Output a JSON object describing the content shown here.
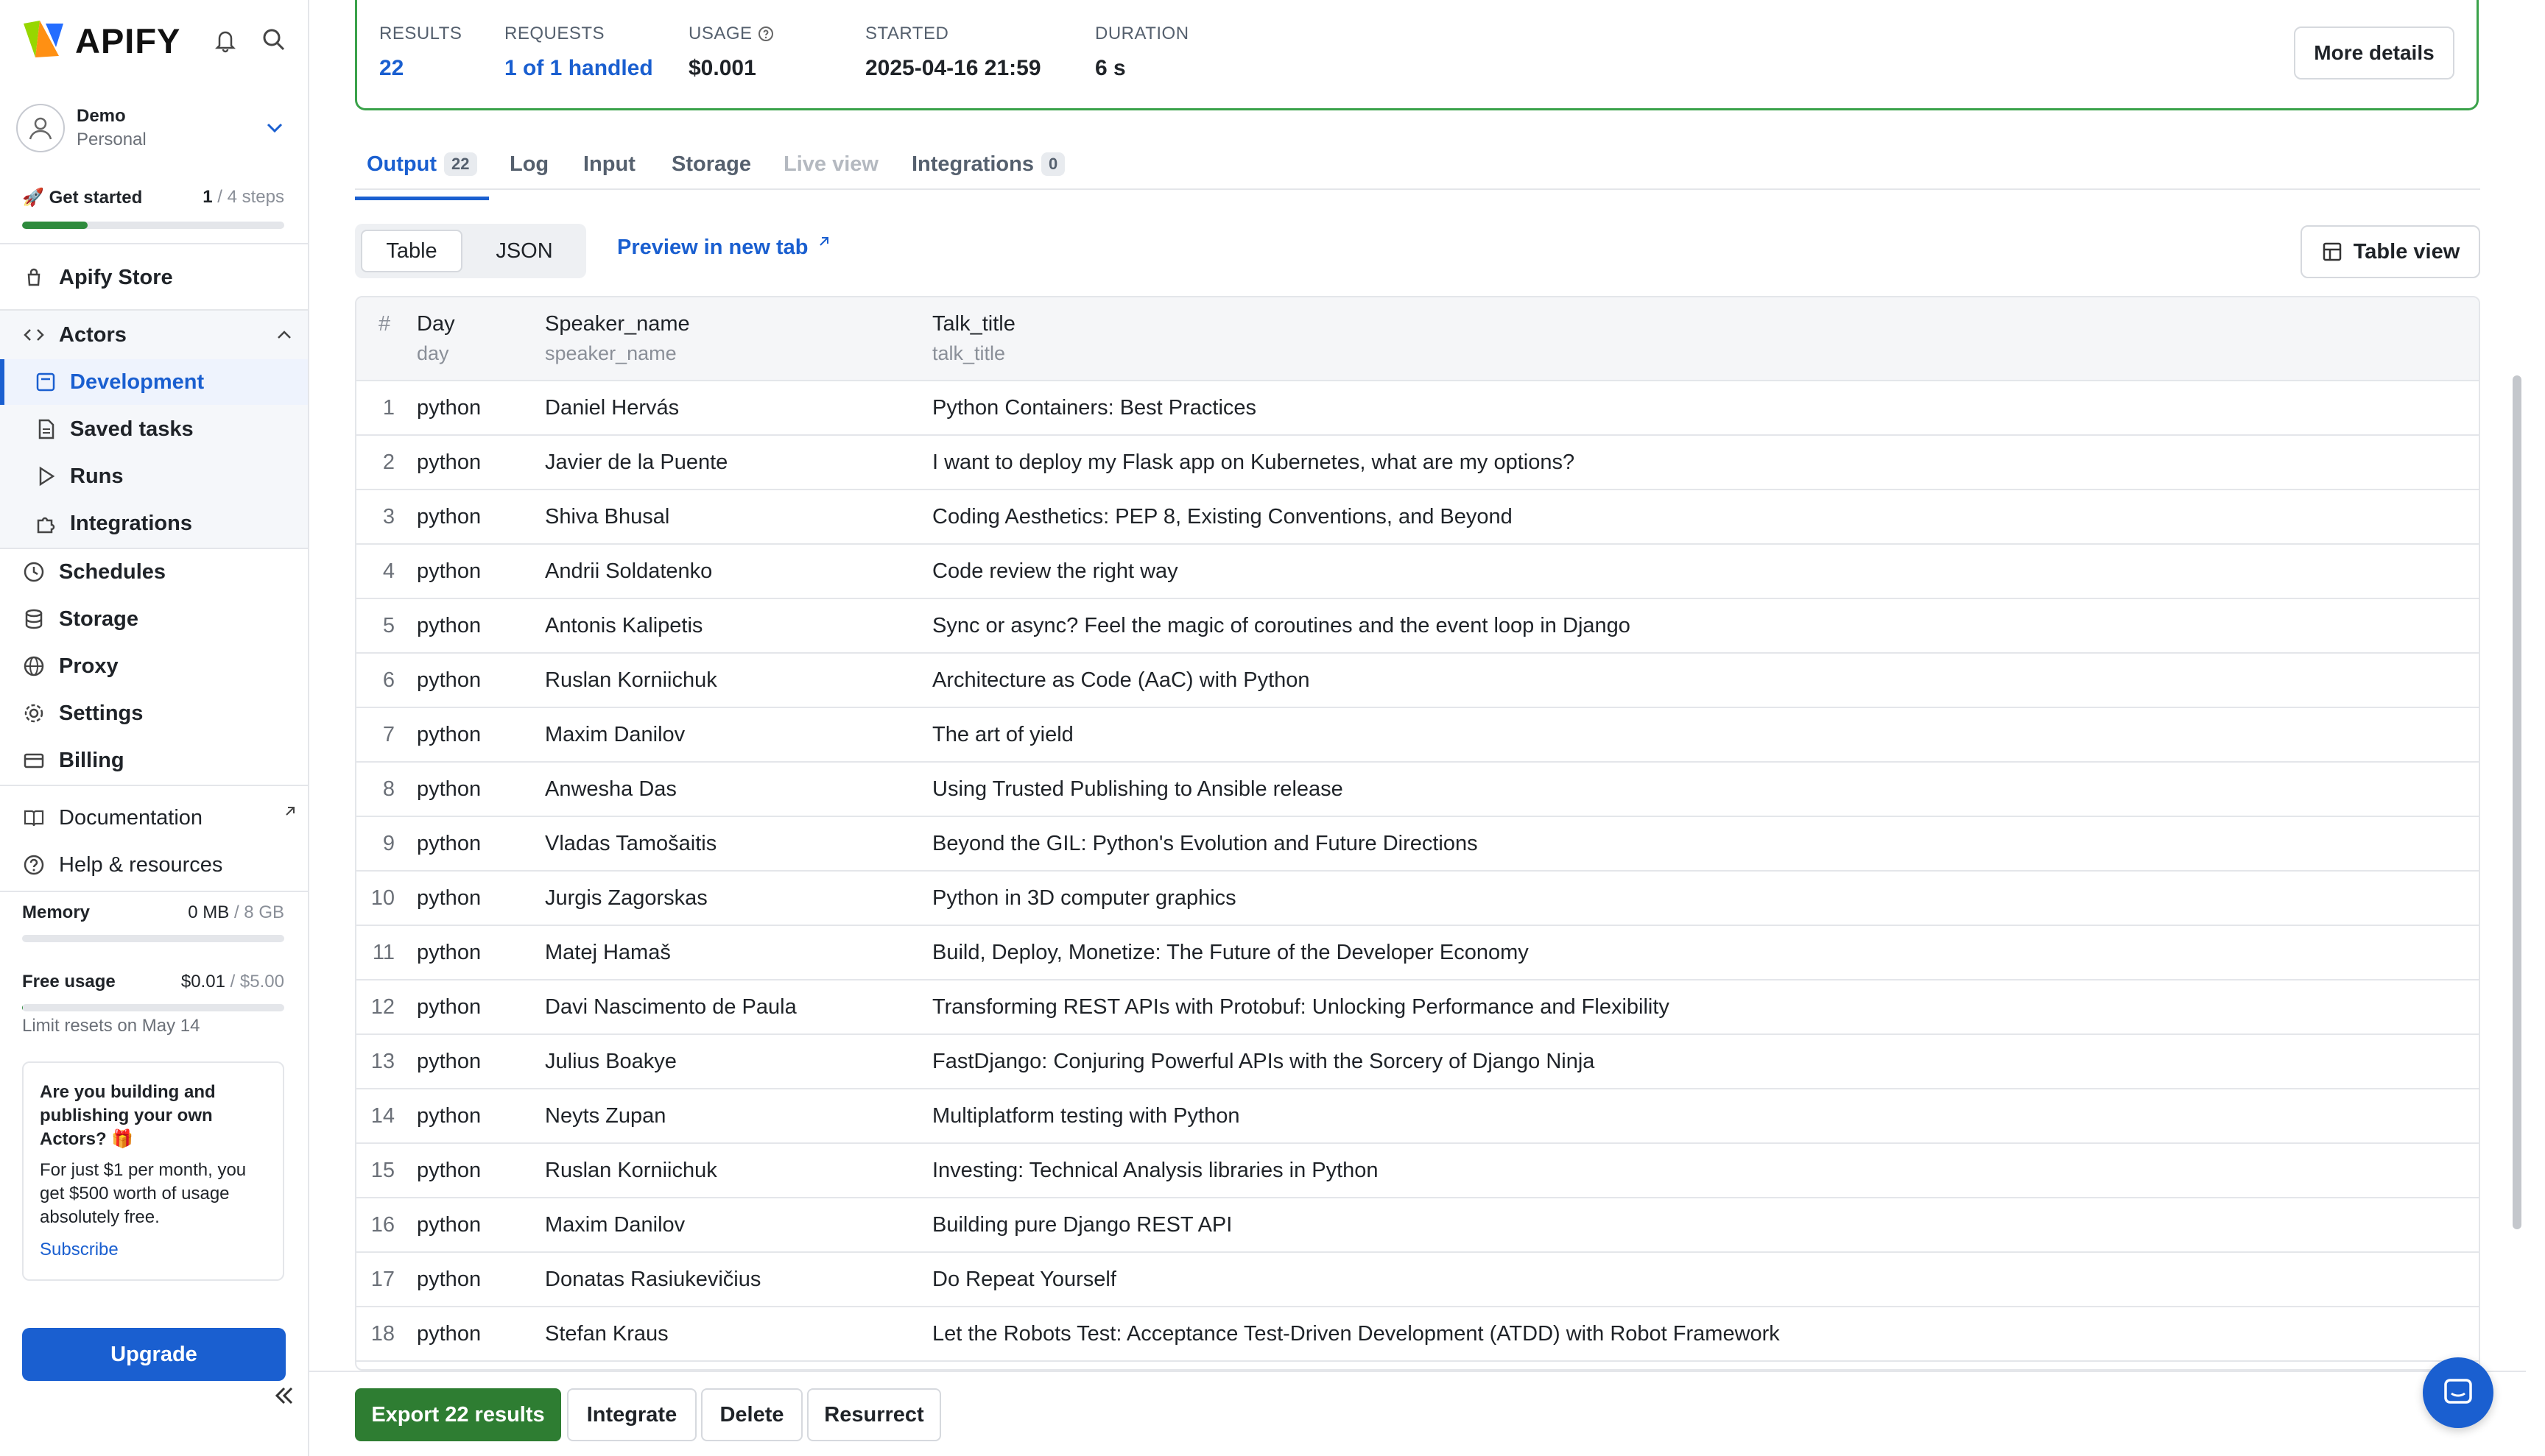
{
  "app": {
    "brand": "APIFY"
  },
  "account": {
    "name": "Demo",
    "type": "Personal"
  },
  "get_started": {
    "label": "Get started",
    "icon": "rocket",
    "current": "1",
    "total": "/ 4 steps",
    "progress": 0.25
  },
  "nav": {
    "store": "Apify Store",
    "actors": "Actors",
    "actor_items": [
      "Development",
      "Saved tasks",
      "Runs",
      "Integrations"
    ],
    "items": [
      "Schedules",
      "Storage",
      "Proxy",
      "Settings",
      "Billing"
    ],
    "docs": "Documentation",
    "help": "Help & resources"
  },
  "memory": {
    "label": "Memory",
    "used": "0 MB",
    "limit": "/ 8 GB",
    "fraction": 0.0
  },
  "usage": {
    "label": "Free usage",
    "used": "$0.01",
    "limit": "/ $5.00",
    "fraction": 0.002
  },
  "reset_note": "Limit resets on May 14",
  "promo": {
    "title": "Are you building and publishing your own Actors? 🎁",
    "body": "For just $1 per month, you get $500 worth of usage absolutely free.",
    "link": "Subscribe"
  },
  "upgrade": "Upgrade",
  "stats": {
    "results": {
      "label": "RESULTS",
      "value": "22"
    },
    "requests": {
      "label": "REQUESTS",
      "value": "1 of 1 handled"
    },
    "usage": {
      "label": "USAGE",
      "value": "$0.001"
    },
    "started": {
      "label": "STARTED",
      "value": "2025-04-16 21:59"
    },
    "duration": {
      "label": "DURATION",
      "value": "6 s"
    },
    "more": "More details"
  },
  "tabs": [
    {
      "label": "Output",
      "badge": "22"
    },
    {
      "label": "Log"
    },
    {
      "label": "Input"
    },
    {
      "label": "Storage"
    },
    {
      "label": "Live view"
    },
    {
      "label": "Integrations",
      "badge": "0"
    }
  ],
  "view": {
    "table": "Table",
    "json": "JSON",
    "preview": "Preview in new tab",
    "table_view": "Table view"
  },
  "table": {
    "columns": [
      {
        "title": "#",
        "sub": ""
      },
      {
        "title": "Day",
        "sub": "day"
      },
      {
        "title": "Speaker_name",
        "sub": "speaker_name"
      },
      {
        "title": "Talk_title",
        "sub": "talk_title"
      }
    ],
    "rows": [
      [
        "1",
        "python",
        "Daniel Hervás",
        "Python Containers: Best Practices"
      ],
      [
        "2",
        "python",
        "Javier de la Puente",
        "I want to deploy my Flask app on Kubernetes, what are my options?"
      ],
      [
        "3",
        "python",
        "Shiva Bhusal",
        "Coding Aesthetics: PEP 8, Existing Conventions, and Beyond"
      ],
      [
        "4",
        "python",
        "Andrii Soldatenko",
        "Code review the right way"
      ],
      [
        "5",
        "python",
        "Antonis Kalipetis",
        "Sync or async? Feel the magic of coroutines and the event loop in Django"
      ],
      [
        "6",
        "python",
        "Ruslan Korniichuk",
        "Architecture as Code (AaC) with Python"
      ],
      [
        "7",
        "python",
        "Maxim Danilov",
        "The art of yield"
      ],
      [
        "8",
        "python",
        "Anwesha Das",
        "Using Trusted Publishing to Ansible release"
      ],
      [
        "9",
        "python",
        "Vladas Tamošaitis",
        "Beyond the GIL: Python's Evolution and Future Directions"
      ],
      [
        "10",
        "python",
        "Jurgis Zagorskas",
        "Python in 3D computer graphics"
      ],
      [
        "11",
        "python",
        "Matej Hamaš",
        "Build, Deploy, Monetize: The Future of the Developer Economy"
      ],
      [
        "12",
        "python",
        "Davi Nascimento de Paula",
        "Transforming REST APIs with Protobuf: Unlocking Performance and Flexibility"
      ],
      [
        "13",
        "python",
        "Julius Boakye",
        "FastDjango: Conjuring Powerful APIs with the Sorcery of Django Ninja"
      ],
      [
        "14",
        "python",
        "Neyts Zupan",
        "Multiplatform testing with Python"
      ],
      [
        "15",
        "python",
        "Ruslan Korniichuk",
        "Investing: Technical Analysis libraries in Python"
      ],
      [
        "16",
        "python",
        "Maxim Danilov",
        "Building pure Django REST API"
      ],
      [
        "17",
        "python",
        "Donatas Rasiukevičius",
        "Do Repeat Yourself"
      ],
      [
        "18",
        "python",
        "Stefan Kraus",
        "Let the Robots Test: Acceptance Test-Driven Development (ATDD) with Robot Framework"
      ]
    ]
  },
  "footer": {
    "export": "Export 22 results",
    "integrate": "Integrate",
    "delete": "Delete",
    "resurrect": "Resurrect"
  },
  "colors": {
    "brand_blue": "#1a5fd0",
    "success_green": "#2e7d32",
    "border": "#e4e6ea"
  }
}
